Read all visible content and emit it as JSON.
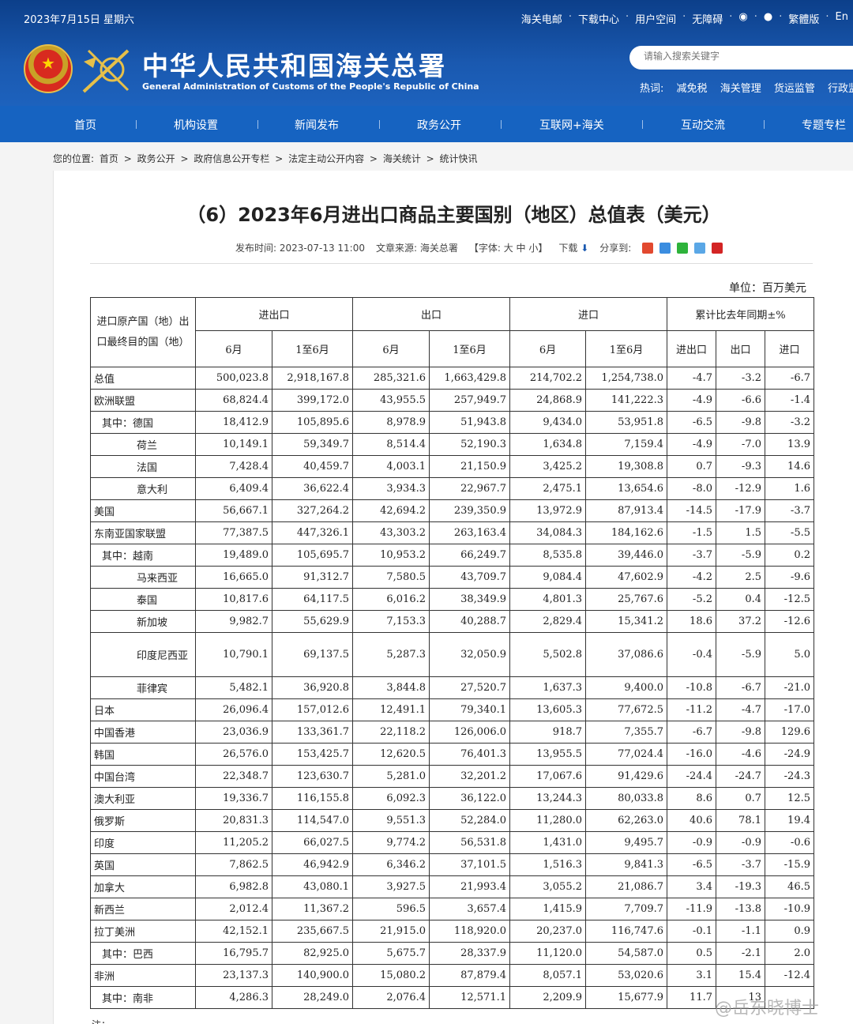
{
  "header": {
    "date": "2023年7月15日 星期六",
    "top_links": [
      "海关电邮",
      "下载中心",
      "用户空间",
      "无障碍",
      "繁體版",
      "En"
    ],
    "site_name_cn": "中华人民共和国海关总署",
    "site_name_en": "General Administration of Customs of the People's Republic of China",
    "search_placeholder": "请输入搜索关键字",
    "hot_label": "热词:",
    "hot_words": [
      "减免税",
      "海关管理",
      "货运监管",
      "行政监管"
    ]
  },
  "nav": [
    "首页",
    "机构设置",
    "新闻发布",
    "政务公开",
    "互联网+海关",
    "互动交流",
    "专题专栏"
  ],
  "breadcrumb": [
    "您的位置:",
    "首页",
    ">",
    "政务公开",
    ">",
    "政府信息公开专栏",
    ">",
    "法定主动公开内容",
    ">",
    "海关统计",
    ">",
    "统计快讯"
  ],
  "article": {
    "title": "（6）2023年6月进出口商品主要国别（地区）总值表（美元）",
    "publish_time": "发布时间: 2023-07-13 11:00",
    "source": "文章来源: 海关总署",
    "font_size_label": "【字体:  大  中  小】",
    "download_label": "下载",
    "share_label": "分享到:",
    "unit": "单位：百万美元",
    "note": "注："
  },
  "table": {
    "head_country": "进口原产国（地）出口最终目的国（地）",
    "groups": [
      "进出口",
      "出口",
      "进口",
      "累计比去年同期±%"
    ],
    "sub": [
      "6月",
      "1至6月",
      "6月",
      "1至6月",
      "6月",
      "1至6月",
      "进出口",
      "出口",
      "进口"
    ],
    "rows": [
      {
        "name": "总值",
        "lvl": 0,
        "v": [
          "500,023.8",
          "2,918,167.8",
          "285,321.6",
          "1,663,429.8",
          "214,702.2",
          "1,254,738.0",
          "-4.7",
          "-3.2",
          "-6.7"
        ]
      },
      {
        "name": "欧洲联盟",
        "lvl": 0,
        "v": [
          "68,824.4",
          "399,172.0",
          "43,955.5",
          "257,949.7",
          "24,868.9",
          "141,222.3",
          "-4.9",
          "-6.6",
          "-1.4"
        ]
      },
      {
        "name": "其中：德国",
        "lvl": 1,
        "v": [
          "18,412.9",
          "105,895.6",
          "8,978.9",
          "51,943.8",
          "9,434.0",
          "53,951.8",
          "-6.5",
          "-9.8",
          "-3.2"
        ]
      },
      {
        "name": "荷兰",
        "lvl": 2,
        "v": [
          "10,149.1",
          "59,349.7",
          "8,514.4",
          "52,190.3",
          "1,634.8",
          "7,159.4",
          "-4.9",
          "-7.0",
          "13.9"
        ]
      },
      {
        "name": "法国",
        "lvl": 2,
        "v": [
          "7,428.4",
          "40,459.7",
          "4,003.1",
          "21,150.9",
          "3,425.2",
          "19,308.8",
          "0.7",
          "-9.3",
          "14.6"
        ]
      },
      {
        "name": "意大利",
        "lvl": 2,
        "v": [
          "6,409.4",
          "36,622.4",
          "3,934.3",
          "22,967.7",
          "2,475.1",
          "13,654.6",
          "-8.0",
          "-12.9",
          "1.6"
        ]
      },
      {
        "name": "美国",
        "lvl": 0,
        "v": [
          "56,667.1",
          "327,264.2",
          "42,694.2",
          "239,350.9",
          "13,972.9",
          "87,913.4",
          "-14.5",
          "-17.9",
          "-3.7"
        ]
      },
      {
        "name": "东南亚国家联盟",
        "lvl": 0,
        "v": [
          "77,387.5",
          "447,326.1",
          "43,303.2",
          "263,163.4",
          "34,084.3",
          "184,162.6",
          "-1.5",
          "1.5",
          "-5.5"
        ]
      },
      {
        "name": "其中：越南",
        "lvl": 1,
        "v": [
          "19,489.0",
          "105,695.7",
          "10,953.2",
          "66,249.7",
          "8,535.8",
          "39,446.0",
          "-3.7",
          "-5.9",
          "0.2"
        ]
      },
      {
        "name": "马来西亚",
        "lvl": 2,
        "v": [
          "16,665.0",
          "91,312.7",
          "7,580.5",
          "43,709.7",
          "9,084.4",
          "47,602.9",
          "-4.2",
          "2.5",
          "-9.6"
        ]
      },
      {
        "name": "泰国",
        "lvl": 2,
        "v": [
          "10,817.6",
          "64,117.5",
          "6,016.2",
          "38,349.9",
          "4,801.3",
          "25,767.6",
          "-5.2",
          "0.4",
          "-12.5"
        ]
      },
      {
        "name": "新加坡",
        "lvl": 2,
        "v": [
          "9,982.7",
          "55,629.9",
          "7,153.3",
          "40,288.7",
          "2,829.4",
          "15,341.2",
          "18.6",
          "37.2",
          "-12.6"
        ]
      },
      {
        "name": "印度尼西亚",
        "lvl": 2,
        "tall": true,
        "v": [
          "10,790.1",
          "69,137.5",
          "5,287.3",
          "32,050.9",
          "5,502.8",
          "37,086.6",
          "-0.4",
          "-5.9",
          "5.0"
        ]
      },
      {
        "name": "菲律宾",
        "lvl": 2,
        "v": [
          "5,482.1",
          "36,920.8",
          "3,844.8",
          "27,520.7",
          "1,637.3",
          "9,400.0",
          "-10.8",
          "-6.7",
          "-21.0"
        ]
      },
      {
        "name": "日本",
        "lvl": 0,
        "v": [
          "26,096.4",
          "157,012.6",
          "12,491.1",
          "79,340.1",
          "13,605.3",
          "77,672.5",
          "-11.2",
          "-4.7",
          "-17.0"
        ]
      },
      {
        "name": "中国香港",
        "lvl": 0,
        "v": [
          "23,036.9",
          "133,361.7",
          "22,118.2",
          "126,006.0",
          "918.7",
          "7,355.7",
          "-6.7",
          "-9.8",
          "129.6"
        ]
      },
      {
        "name": "韩国",
        "lvl": 0,
        "v": [
          "26,576.0",
          "153,425.7",
          "12,620.5",
          "76,401.3",
          "13,955.5",
          "77,024.4",
          "-16.0",
          "-4.6",
          "-24.9"
        ]
      },
      {
        "name": "中国台湾",
        "lvl": 0,
        "v": [
          "22,348.7",
          "123,630.7",
          "5,281.0",
          "32,201.2",
          "17,067.6",
          "91,429.6",
          "-24.4",
          "-24.7",
          "-24.3"
        ]
      },
      {
        "name": "澳大利亚",
        "lvl": 0,
        "v": [
          "19,336.7",
          "116,155.8",
          "6,092.3",
          "36,122.0",
          "13,244.3",
          "80,033.8",
          "8.6",
          "0.7",
          "12.5"
        ]
      },
      {
        "name": "俄罗斯",
        "lvl": 0,
        "v": [
          "20,831.3",
          "114,547.0",
          "9,551.3",
          "52,284.0",
          "11,280.0",
          "62,263.0",
          "40.6",
          "78.1",
          "19.4"
        ]
      },
      {
        "name": "印度",
        "lvl": 0,
        "v": [
          "11,205.2",
          "66,027.5",
          "9,774.2",
          "56,531.8",
          "1,431.0",
          "9,495.7",
          "-0.9",
          "-0.9",
          "-0.6"
        ]
      },
      {
        "name": "英国",
        "lvl": 0,
        "v": [
          "7,862.5",
          "46,942.9",
          "6,346.2",
          "37,101.5",
          "1,516.3",
          "9,841.3",
          "-6.5",
          "-3.7",
          "-15.9"
        ]
      },
      {
        "name": "加拿大",
        "lvl": 0,
        "v": [
          "6,982.8",
          "43,080.1",
          "3,927.5",
          "21,993.4",
          "3,055.2",
          "21,086.7",
          "3.4",
          "-19.3",
          "46.5"
        ]
      },
      {
        "name": "新西兰",
        "lvl": 0,
        "v": [
          "2,012.4",
          "11,367.2",
          "596.5",
          "3,657.4",
          "1,415.9",
          "7,709.7",
          "-11.9",
          "-13.8",
          "-10.9"
        ]
      },
      {
        "name": "拉丁美洲",
        "lvl": 0,
        "v": [
          "42,152.1",
          "235,667.5",
          "21,915.0",
          "118,920.0",
          "20,237.0",
          "116,747.6",
          "-0.1",
          "-1.1",
          "0.9"
        ]
      },
      {
        "name": "其中：巴西",
        "lvl": 1,
        "v": [
          "16,795.7",
          "82,925.0",
          "5,675.7",
          "28,337.9",
          "11,120.0",
          "54,587.0",
          "0.5",
          "-2.1",
          "2.0"
        ]
      },
      {
        "name": "非洲",
        "lvl": 0,
        "v": [
          "23,137.3",
          "140,900.0",
          "15,080.2",
          "87,879.4",
          "8,057.1",
          "53,020.6",
          "3.1",
          "15.4",
          "-12.4"
        ]
      },
      {
        "name": "其中：南非",
        "lvl": 1,
        "v": [
          "4,286.3",
          "28,249.0",
          "2,076.4",
          "12,571.1",
          "2,209.9",
          "15,677.9",
          "11.7",
          "13",
          ""
        ]
      }
    ]
  },
  "watermark": "@岳东晓博士"
}
